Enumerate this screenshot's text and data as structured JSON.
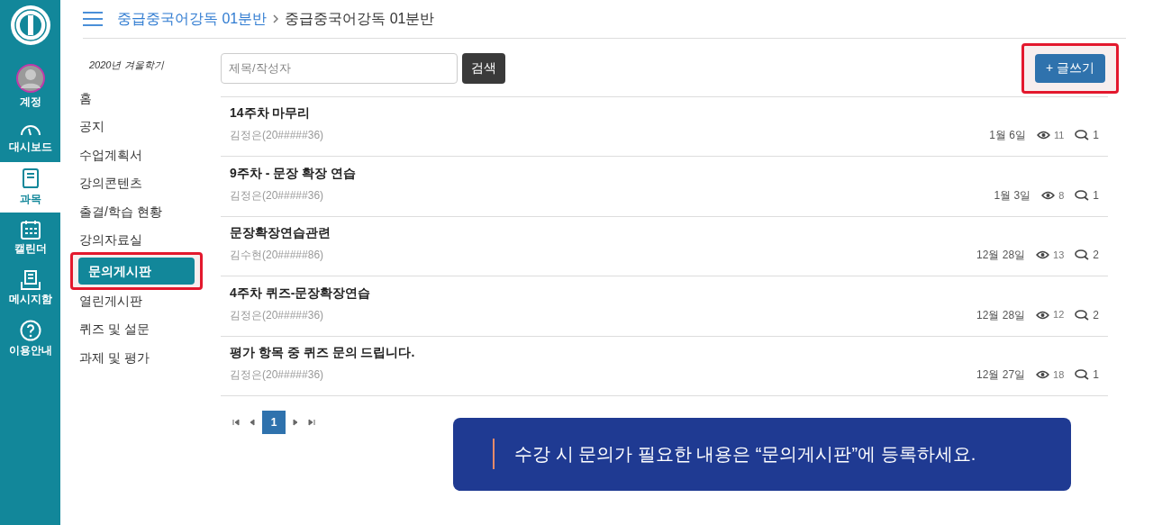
{
  "nav": [
    {
      "label": "계정",
      "kind": "avatar",
      "selected": false
    },
    {
      "label": "대시보드",
      "kind": "dashboard",
      "selected": false
    },
    {
      "label": "과목",
      "kind": "book",
      "selected": true
    },
    {
      "label": "캘린더",
      "kind": "calendar",
      "selected": false
    },
    {
      "label": "메시지함",
      "kind": "inbox",
      "selected": false
    },
    {
      "label": "이용안내",
      "kind": "help",
      "selected": false
    }
  ],
  "breadcrumb": [
    "중급중국어강독 01분반",
    "중급중국어강독 01분반"
  ],
  "course_menu": {
    "term": "2020년 겨울학기",
    "items": [
      {
        "label": "홈",
        "selected": false
      },
      {
        "label": "공지",
        "selected": false
      },
      {
        "label": "수업계획서",
        "selected": false
      },
      {
        "label": "강의콘텐츠",
        "selected": false
      },
      {
        "label": "출결/학습 현황",
        "selected": false
      },
      {
        "label": "강의자료실",
        "selected": false
      },
      {
        "label": "문의게시판",
        "selected": true
      },
      {
        "label": "열린게시판",
        "selected": false
      },
      {
        "label": "퀴즈 및 설문",
        "selected": false
      },
      {
        "label": "과제 및 평가",
        "selected": false
      }
    ]
  },
  "search": {
    "placeholder": "제목/작성자",
    "button": "검색"
  },
  "write_button": "+ 글쓰기",
  "posts": [
    {
      "title": "14주차 마무리",
      "author": "김정은(20#####36)",
      "date": "1월 6일",
      "views": "11",
      "comments": "1"
    },
    {
      "title": "9주차 - 문장 확장 연습",
      "author": "김정은(20#####36)",
      "date": "1월 3일",
      "views": "8",
      "comments": "1"
    },
    {
      "title": "문장확장연습관련",
      "author": "김수현(20#####86)",
      "date": "12월 28일",
      "views": "13",
      "comments": "2"
    },
    {
      "title": "4주차 퀴즈-문장확장연습",
      "author": "김정은(20#####36)",
      "date": "12월 28일",
      "views": "12",
      "comments": "2"
    },
    {
      "title": "평가 항목 중 퀴즈 문의 드립니다.",
      "author": "김정은(20#####36)",
      "date": "12월 27일",
      "views": "18",
      "comments": "1"
    }
  ],
  "pagination": [
    {
      "label": "1",
      "selected": true
    }
  ],
  "callout": "수강 시 문의가 필요한 내용은 “문의게시판”에 등록하세요."
}
